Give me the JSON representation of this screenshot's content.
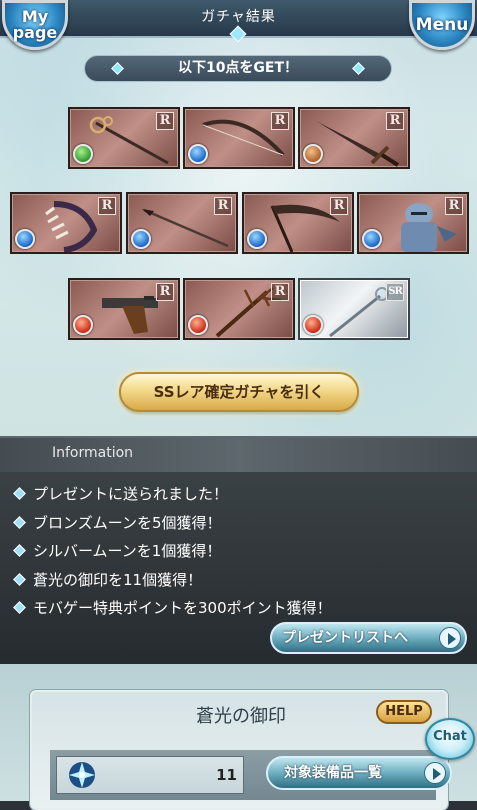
{
  "header": {
    "title": "ガチャ結果",
    "mypage_label": "My page",
    "menu_label": "Menu"
  },
  "banner": {
    "text": "以下10点をGET！"
  },
  "items": [
    {
      "rarity": "R",
      "element": "wind",
      "icon": "staff-icon"
    },
    {
      "rarity": "R",
      "element": "water",
      "icon": "bow-icon"
    },
    {
      "rarity": "R",
      "element": "earth",
      "icon": "sword-icon"
    },
    {
      "rarity": "R",
      "element": "water",
      "icon": "claw-icon"
    },
    {
      "rarity": "R",
      "element": "water",
      "icon": "spear-icon"
    },
    {
      "rarity": "R",
      "element": "water",
      "icon": "scythe-icon"
    },
    {
      "rarity": "R",
      "element": "water",
      "icon": "armored-knight-icon"
    },
    {
      "rarity": "R",
      "element": "fire",
      "icon": "gun-icon"
    },
    {
      "rarity": "R",
      "element": "fire",
      "icon": "branch-staff-icon"
    },
    {
      "rarity": "SR",
      "element": "fire",
      "icon": "scepter-icon"
    }
  ],
  "gacha_button": {
    "label": "SSレア確定ガチャを引く"
  },
  "information": {
    "title": "Information",
    "items": [
      "プレゼントに送られました！",
      "ブロンズムーンを5個獲得！",
      "シルバームーンを1個獲得！",
      "蒼光の御印を11個獲得！",
      "モバゲー特典ポイントを300ポイント獲得！"
    ],
    "present_button": "プレゼントリストへ"
  },
  "seal_panel": {
    "title": "蒼光の御印",
    "help_label": "HELP",
    "count": "11",
    "equip_button": "対象装備品一覧",
    "seal_icon": "blue-star-seal-icon"
  },
  "chat_button": {
    "label": "Chat"
  },
  "colors": {
    "header": "#2f4456",
    "card_r": "#b07c74",
    "card_sr": "#dfe6ea",
    "gold_button": "#f2d98a",
    "blue_button": "#6eaec0",
    "info_panel": "#33393d"
  }
}
